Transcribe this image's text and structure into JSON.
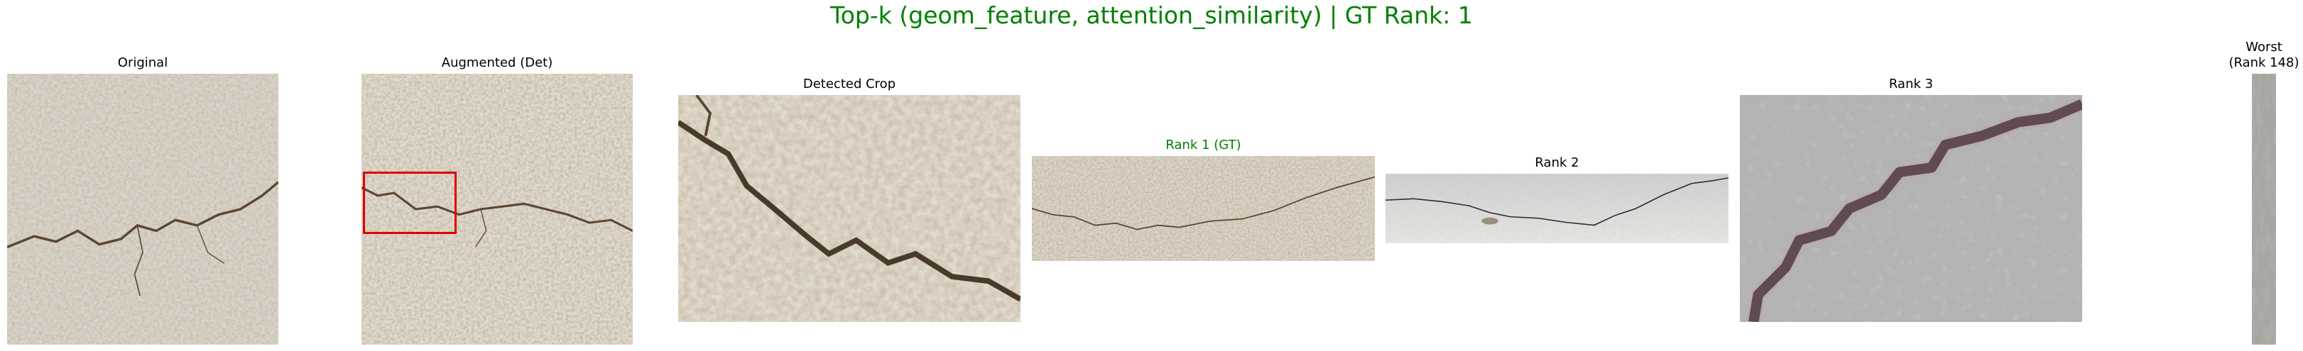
{
  "figure": {
    "title": "Top-k (geom_feature, attention_similarity) | GT Rank: 1",
    "title_color": "#008000",
    "panels": [
      {
        "id": "original",
        "label": "Original"
      },
      {
        "id": "augmented",
        "label": "Augmented (Det)",
        "box_color": "#e00000"
      },
      {
        "id": "detected",
        "label": "Detected Crop"
      },
      {
        "id": "rank1",
        "label": "Rank 1 (GT)",
        "label_color": "#008000"
      },
      {
        "id": "rank2",
        "label": "Rank 2"
      },
      {
        "id": "rank3",
        "label": "Rank 3"
      },
      {
        "id": "worst",
        "label_line1": "Worst",
        "label_line2": "(Rank 148)"
      }
    ]
  }
}
